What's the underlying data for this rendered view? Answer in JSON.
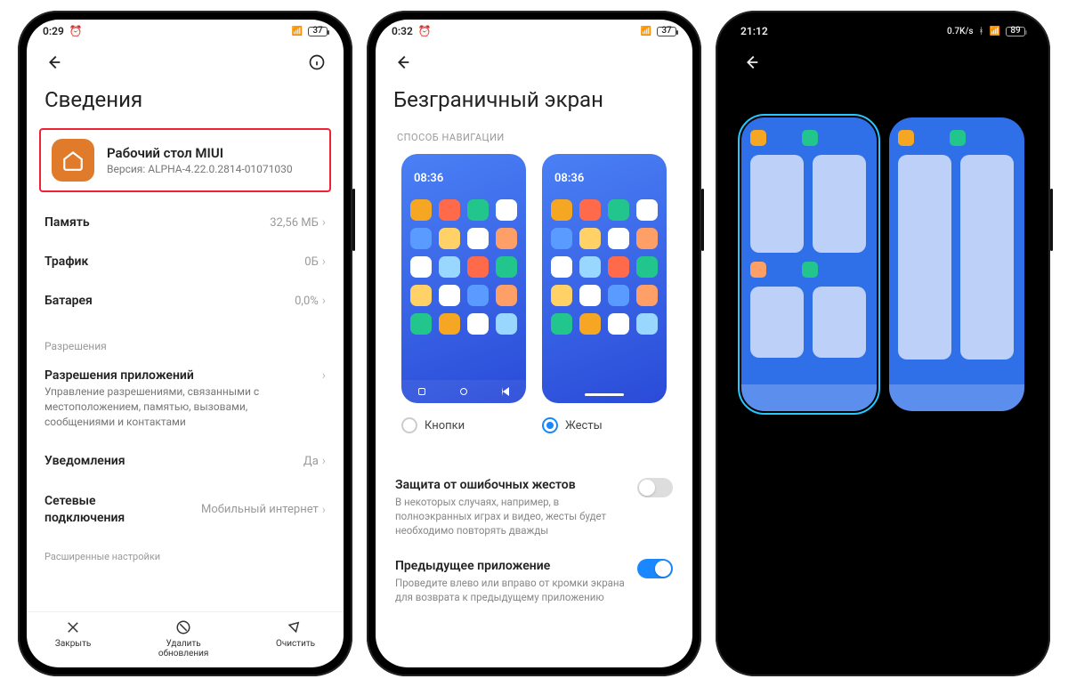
{
  "phone1": {
    "status": {
      "time": "0:29",
      "battery": "37"
    },
    "title": "Сведения",
    "app": {
      "name": "Рабочий стол MIUI",
      "version": "Версия: ALPHA-4.22.0.2814-01071030"
    },
    "rows": {
      "memory": {
        "label": "Память",
        "value": "32,56 МБ"
      },
      "traffic": {
        "label": "Трафик",
        "value": "0Б"
      },
      "battery": {
        "label": "Батарея",
        "value": "0,0%"
      }
    },
    "permissions_section": "Разрешения",
    "perm": {
      "label": "Разрешения приложений",
      "desc": "Управление разрешениями, связанными с местоположением, памятью, вызовами, сообщениями и контактами"
    },
    "notif": {
      "label": "Уведомления",
      "value": "Да"
    },
    "net": {
      "label": "Сетевые подключения",
      "value": "Мобильный интернет"
    },
    "ext_section": "Расширенные настройки",
    "bottom": {
      "close": "Закрыть",
      "uninstall": "Удалить обновления",
      "clear": "Очистить"
    }
  },
  "phone2": {
    "status": {
      "time": "0:32",
      "battery": "37"
    },
    "title": "Безграничный экран",
    "nav_section": "СПОСОБ НАВИГАЦИИ",
    "preview_time": "08:36",
    "opt_buttons": "Кнопки",
    "opt_gestures": "Жесты",
    "protect": {
      "title": "Защита от ошибочных жестов",
      "desc": "В некоторых случаях, например, в полноэкранных играх и видео, жесты будет необходимо повторять дважды"
    },
    "prev_app": {
      "title": "Предыдущее приложение",
      "desc": "Проведите влево или вправо от кромки экрана для возврата к предыдущему приложению"
    }
  },
  "phone3": {
    "status": {
      "time": "21:12",
      "speed": "0.7K/s",
      "battery": "89"
    }
  },
  "icon_colors": [
    "#f5a623",
    "#ff6b4a",
    "#22c58b",
    "#ffffff",
    "#5a9bff",
    "#ffd166",
    "#ff9f68",
    "#9ad7ff"
  ]
}
